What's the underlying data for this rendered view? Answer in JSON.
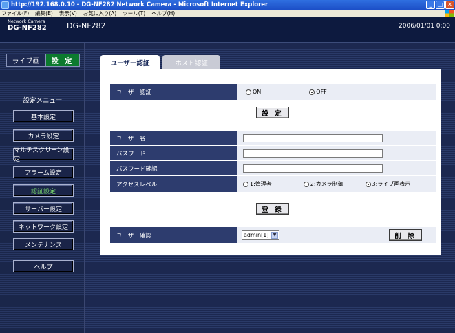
{
  "window": {
    "title": "http://192.168.0.10 - DG-NF282 Network Camera - Microsoft Internet Explorer",
    "menu": [
      "ファイル(F)",
      "編集(E)",
      "表示(V)",
      "お気に入り(A)",
      "ツール(T)",
      "ヘルプ(H)"
    ],
    "controls": [
      "_",
      "□",
      "✕"
    ]
  },
  "header": {
    "network_camera": "Network Camera",
    "model": "DG-NF282",
    "model_center": "DG-NF282",
    "datetime": "2006/01/01  0:00"
  },
  "sidebar": {
    "live_tab": "ライブ画",
    "settings_tab": "設 定",
    "menu_title": "設定メニュー",
    "items": [
      {
        "label": "基本設定"
      },
      {
        "label": "カメラ設定"
      },
      {
        "label": "マルチスクリーン設定"
      },
      {
        "label": "アラーム設定"
      },
      {
        "label": "認証設定"
      },
      {
        "label": "サーバー設定"
      },
      {
        "label": "ネットワーク設定"
      },
      {
        "label": "メンテナンス"
      },
      {
        "label": "ヘルプ"
      }
    ]
  },
  "tabs": {
    "user_auth": "ユーザー認証",
    "host_auth": "ホスト認証"
  },
  "form": {
    "user_auth_label": "ユーザー認証",
    "on_label": "ON",
    "off_label": "OFF",
    "set_button": "設 定",
    "username_label": "ユーザー名",
    "password_label": "パスワード",
    "password_confirm_label": "パスワード確認",
    "access_level_label": "アクセスレベル",
    "access_options": [
      "1:管理者",
      "2:カメラ制御",
      "3:ライブ画表示"
    ],
    "register_button": "登 録",
    "user_check_label": "ユーザー確認",
    "user_select_value": "admin[1]",
    "delete_button": "削 除"
  },
  "colors": {
    "header_bg": "#0d1a3f",
    "settings_tab_bg": "#0c7a2e",
    "active_menu_text": "#7fe06e",
    "row_label_bg": "#2d3c6e",
    "row_value_bg": "#eaedf5"
  },
  "state": {
    "user_auth": "OFF",
    "access_level": "3:ライブ画表示"
  }
}
